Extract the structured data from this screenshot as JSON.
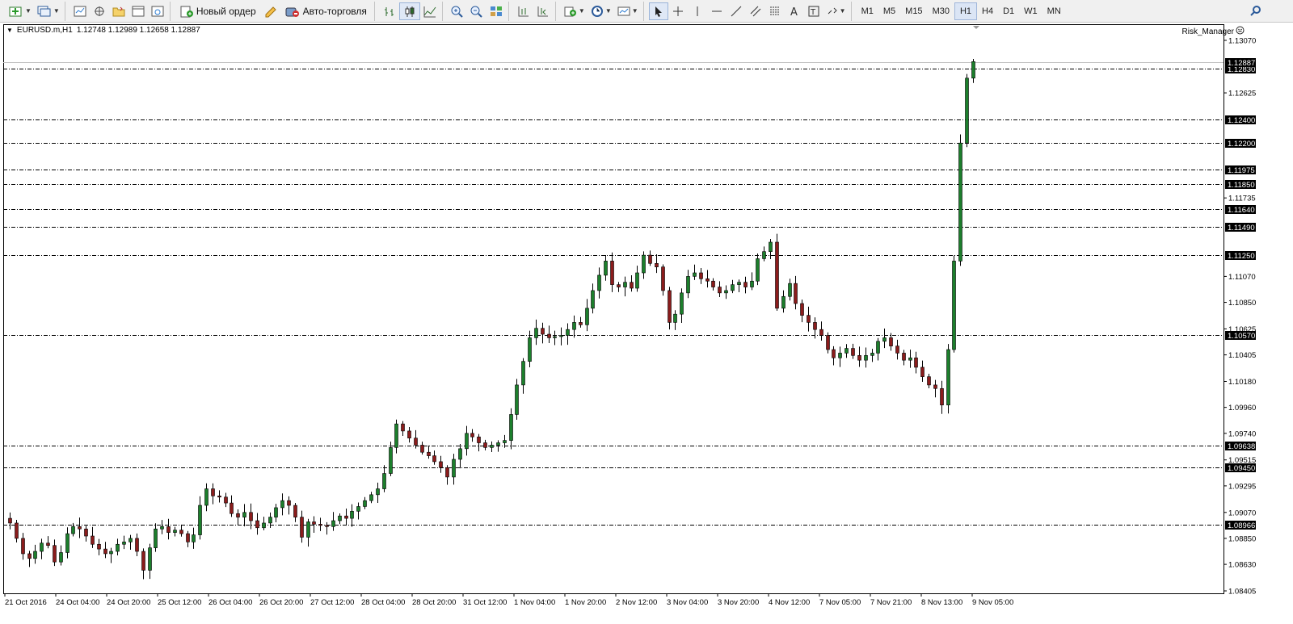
{
  "toolbar": {
    "new_order_label": "Новый ордер",
    "autotrading_label": "Авто-торговля",
    "timeframes": [
      "M1",
      "M5",
      "M15",
      "M30",
      "H1",
      "H4",
      "D1",
      "W1",
      "MN"
    ],
    "active_timeframe": "H1",
    "icons": [
      "new-chart-icon",
      "profiles-icon",
      "market-watch-icon",
      "data-window-icon",
      "navigator-icon",
      "terminal-icon",
      "strategy-tester-icon",
      "new-order-icon",
      "metaeditor-icon",
      "autotrading-icon",
      "bar-chart-icon",
      "candlestick-icon",
      "line-chart-icon",
      "zoom-in-icon",
      "zoom-out-icon",
      "tile-windows-icon",
      "chart-shift-icon",
      "autoscroll-icon",
      "indicators-icon",
      "periods-icon",
      "templates-icon",
      "cursor-icon",
      "crosshair-icon",
      "vertical-line-icon",
      "horizontal-line-icon",
      "trendline-icon",
      "equidistant-channel-icon",
      "fibonacci-icon",
      "text-icon",
      "text-label-icon",
      "arrows-icon",
      "search-icon"
    ]
  },
  "chart": {
    "symbol_timeframe": "EURUSD.m,H1",
    "ohlc": "1.12748 1.12989 1.12658 1.12887",
    "ea_name": "Risk_Manager",
    "ea_icon": "smiley-icon"
  },
  "colors": {
    "bull_body": "#1c7f2c",
    "bear_body": "#8b1c1c",
    "wick": "#000000",
    "bid_line": "#c0c0c0",
    "level_line": "#000000",
    "price_tag_bg": "#000000",
    "price_tag_text": "#ffffff"
  },
  "chart_data": {
    "type": "candlestick",
    "symbol": "EURUSD.m",
    "timeframe": "H1",
    "current_price": 1.12887,
    "y_axis_ticks": [
      1.1307,
      1.12625,
      1.11735,
      1.1107,
      1.1085,
      1.10625,
      1.10405,
      1.1018,
      1.0996,
      1.0974,
      1.09515,
      1.09295,
      1.0907,
      1.0885,
      1.0863,
      1.08405
    ],
    "price_levels": [
      1.1283,
      1.124,
      1.122,
      1.11975,
      1.1185,
      1.1164,
      1.1149,
      1.1125,
      1.1057,
      1.09638,
      1.0945,
      1.08966
    ],
    "x_axis_labels": [
      "21 Oct 2016",
      "24 Oct 04:00",
      "24 Oct 20:00",
      "25 Oct 12:00",
      "26 Oct 04:00",
      "26 Oct 20:00",
      "27 Oct 12:00",
      "28 Oct 04:00",
      "28 Oct 20:00",
      "31 Oct 12:00",
      "1 Nov 04:00",
      "1 Nov 20:00",
      "2 Nov 12:00",
      "3 Nov 04:00",
      "3 Nov 20:00",
      "4 Nov 12:00",
      "7 Nov 05:00",
      "7 Nov 21:00",
      "8 Nov 13:00",
      "9 Nov 05:00"
    ],
    "ylim": [
      1.08405,
      1.1307
    ],
    "price_path": [
      1.0898,
      1.0885,
      1.0872,
      1.0868,
      1.0874,
      1.0881,
      1.0879,
      1.0865,
      1.0873,
      1.0889,
      1.0895,
      1.0893,
      1.0887,
      1.088,
      1.0876,
      1.0872,
      1.0874,
      1.088,
      1.0882,
      1.0885,
      1.0874,
      1.0858,
      1.0877,
      1.0893,
      1.0895,
      1.089,
      1.0892,
      1.0889,
      1.0882,
      1.0888,
      1.0913,
      1.0927,
      1.0921,
      1.092,
      1.0915,
      1.0906,
      1.0903,
      1.0907,
      1.09,
      1.0894,
      1.0898,
      1.0903,
      1.0911,
      1.0917,
      1.0913,
      1.0903,
      1.0886,
      1.0899,
      1.0897,
      1.0896,
      1.0895,
      1.09,
      1.0904,
      1.0902,
      1.0908,
      1.0912,
      1.0917,
      1.0922,
      1.0927,
      1.094,
      1.0962,
      1.0982,
      1.0976,
      1.097,
      1.0964,
      1.0958,
      1.0955,
      1.095,
      1.0945,
      1.0937,
      1.0952,
      1.0961,
      1.0974,
      1.0971,
      1.0966,
      1.0962,
      1.0964,
      1.0966,
      1.0968,
      1.099,
      1.1015,
      1.1035,
      1.1055,
      1.1063,
      1.1058,
      1.1055,
      1.1056,
      1.1057,
      1.1062,
      1.1068,
      1.1066,
      1.108,
      1.1095,
      1.1108,
      1.112,
      1.11,
      1.1098,
      1.1102,
      1.1097,
      1.111,
      1.1125,
      1.1118,
      1.1115,
      1.1095,
      1.1068,
      1.1075,
      1.1093,
      1.1107,
      1.111,
      1.1105,
      1.1103,
      1.1098,
      1.1093,
      1.1095,
      1.11,
      1.1102,
      1.1098,
      1.1103,
      1.1122,
      1.1128,
      1.1136,
      1.108,
      1.109,
      1.1101,
      1.1084,
      1.1074,
      1.1068,
      1.1062,
      1.1057,
      1.1045,
      1.1038,
      1.1042,
      1.1046,
      1.104,
      1.1036,
      1.104,
      1.1042,
      1.1052,
      1.1055,
      1.1048,
      1.1042,
      1.1036,
      1.1038,
      1.103,
      1.1022,
      1.1015,
      1.1012,
      1.0998,
      1.1045,
      1.112,
      1.122,
      1.1275,
      1.1289
    ],
    "series_direction": [
      "down",
      "down",
      "down",
      "up",
      "up",
      "down",
      "down",
      "up",
      "up",
      "up",
      "down",
      "down",
      "down",
      "down",
      "up",
      "up",
      "up",
      "up",
      "down",
      "down",
      "up",
      "up",
      "up",
      "up",
      "down",
      "up",
      "down",
      "down",
      "up",
      "up",
      "up",
      "down",
      "down",
      "down",
      "down",
      "up",
      "up",
      "down",
      "down",
      "up",
      "up",
      "up",
      "up",
      "down",
      "down",
      "down",
      "up",
      "down",
      "down",
      "down",
      "up",
      "up",
      "down",
      "up",
      "up",
      "up",
      "up",
      "up",
      "up",
      "up",
      "up",
      "down",
      "down",
      "down",
      "down",
      "down",
      "down",
      "down",
      "down",
      "up",
      "up",
      "up",
      "down",
      "down",
      "down",
      "up",
      "up",
      "up",
      "up",
      "up",
      "up",
      "up",
      "up",
      "down",
      "down",
      "up",
      "up",
      "up",
      "up",
      "down",
      "up",
      "up",
      "up",
      "up",
      "down",
      "down",
      "up",
      "down",
      "up",
      "up",
      "down",
      "down",
      "down",
      "down",
      "up",
      "up",
      "up",
      "up",
      "down",
      "down",
      "down",
      "down",
      "up",
      "up",
      "up",
      "down",
      "up",
      "up",
      "up",
      "up",
      "down",
      "up",
      "up",
      "down",
      "down",
      "down",
      "down",
      "down",
      "down",
      "up",
      "up",
      "down",
      "down",
      "up",
      "up",
      "up",
      "up",
      "down",
      "down",
      "down",
      "up",
      "down",
      "down",
      "down",
      "down",
      "up",
      "up",
      "up",
      "up",
      "up"
    ]
  }
}
